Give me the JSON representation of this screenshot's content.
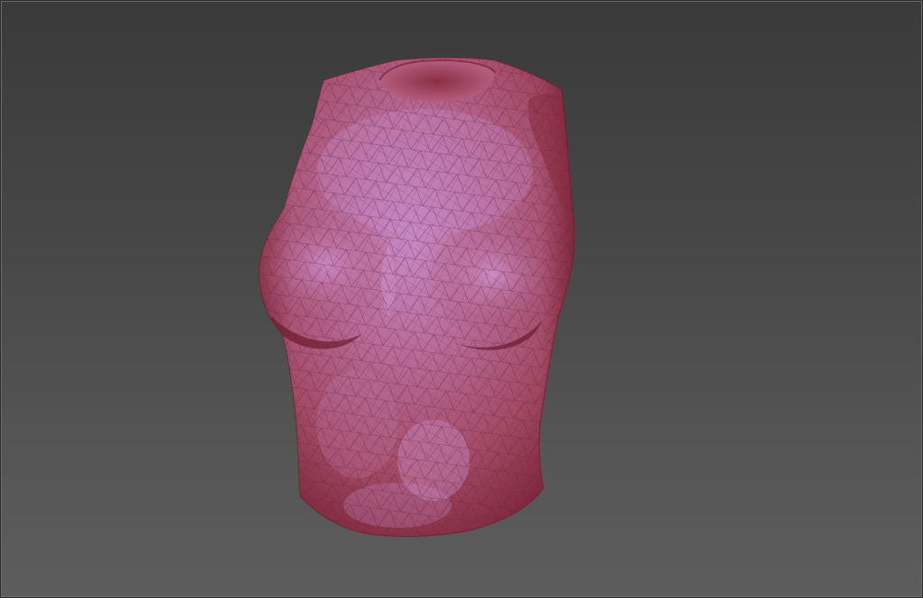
{
  "viewport": {
    "background_top": "#3a3a3a",
    "background_bottom": "#5d5d5d",
    "border_color": "#6a6a6a"
  },
  "model": {
    "subject": "3d-torso-mesh",
    "render_mode": "shaded-with-wireframe",
    "base_color": "#b8566e",
    "highlight_color": "#c889c6",
    "shadow_color": "#7a2236",
    "wire_color": "#5a2a3a"
  }
}
